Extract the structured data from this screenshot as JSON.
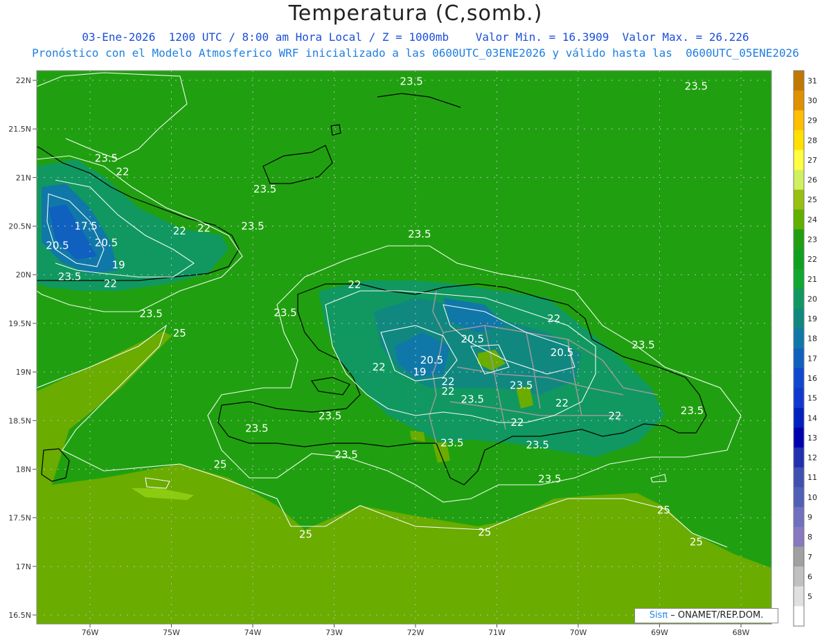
{
  "header": {
    "title": "Temperatura (C,somb.)",
    "line1": "03-Ene-2026  1200 UTC / 8:00 am Hora Local / Z = 1000mb    Valor Min. = 16.3909  Valor Max. = 26.226",
    "line2": "Pronóstico con el Modelo Atmosferico WRF inicializado a las 0600UTC_03ENE2026 y válido hasta las  0600UTC_05ENE2026"
  },
  "axes": {
    "lat_labels": [
      "22N",
      "21.5N",
      "21N",
      "20.5N",
      "20N",
      "19.5N",
      "19N",
      "18.5N",
      "18N",
      "17.5N",
      "17N",
      "16.5N"
    ],
    "lon_labels": [
      "76W",
      "75W",
      "74W",
      "73W",
      "72W",
      "71W",
      "70W",
      "69W",
      "68W"
    ]
  },
  "colorbar": {
    "labels": [
      "31",
      "30",
      "29",
      "28",
      "27",
      "26",
      "25",
      "24",
      "23",
      "22",
      "21",
      "20",
      "19",
      "18",
      "17",
      "16",
      "15",
      "14",
      "13",
      "12",
      "11",
      "10",
      "9",
      "8",
      "7",
      "6",
      "5"
    ],
    "colors": [
      "#c07800",
      "#e09000",
      "#ffbe00",
      "#ffe000",
      "#ffff40",
      "#d0f060",
      "#98c010",
      "#60b000",
      "#20a010",
      "#10a020",
      "#10a830",
      "#109860",
      "#108880",
      "#1078a8",
      "#1060c0",
      "#1048d0",
      "#1038d0",
      "#0020c0",
      "#0000b0",
      "#2030b0",
      "#4050b0",
      "#5060b8",
      "#7070c0",
      "#8878c0",
      "#a0a0a0",
      "#c0c0c0",
      "#e0e0e0",
      "#ffffff"
    ]
  },
  "contour_labels": [
    {
      "text": "23.5",
      "lon": -72.05,
      "lat": 21.99
    },
    {
      "text": "23.5",
      "lon": -68.55,
      "lat": 21.94
    },
    {
      "text": "23.5",
      "lon": -75.8,
      "lat": 21.2
    },
    {
      "text": "22",
      "lon": -75.6,
      "lat": 21.06
    },
    {
      "text": "23.5",
      "lon": -73.85,
      "lat": 20.88
    },
    {
      "text": "17.5",
      "lon": -76.05,
      "lat": 20.5
    },
    {
      "text": "22",
      "lon": -74.9,
      "lat": 20.45
    },
    {
      "text": "22",
      "lon": -74.6,
      "lat": 20.48
    },
    {
      "text": "23.5",
      "lon": -74.0,
      "lat": 20.5
    },
    {
      "text": "23.5",
      "lon": -71.95,
      "lat": 20.42
    },
    {
      "text": "20.5",
      "lon": -76.4,
      "lat": 20.3
    },
    {
      "text": "20.5",
      "lon": -75.8,
      "lat": 20.33
    },
    {
      "text": "19",
      "lon": -75.65,
      "lat": 20.1
    },
    {
      "text": "23.5",
      "lon": -76.25,
      "lat": 19.98
    },
    {
      "text": "22",
      "lon": -75.75,
      "lat": 19.91
    },
    {
      "text": "22",
      "lon": -72.75,
      "lat": 19.9
    },
    {
      "text": "23.5",
      "lon": -75.25,
      "lat": 19.6
    },
    {
      "text": "23.5",
      "lon": -73.6,
      "lat": 19.61
    },
    {
      "text": "25",
      "lon": -74.9,
      "lat": 19.4
    },
    {
      "text": "22",
      "lon": -70.3,
      "lat": 19.55
    },
    {
      "text": "20.5",
      "lon": -71.3,
      "lat": 19.34
    },
    {
      "text": "23.5",
      "lon": -69.2,
      "lat": 19.28
    },
    {
      "text": "20.5",
      "lon": -70.2,
      "lat": 19.2
    },
    {
      "text": "20.5",
      "lon": -71.8,
      "lat": 19.12
    },
    {
      "text": "22",
      "lon": -72.45,
      "lat": 19.05
    },
    {
      "text": "19",
      "lon": -71.95,
      "lat": 19.0
    },
    {
      "text": "22",
      "lon": -71.6,
      "lat": 18.9
    },
    {
      "text": "23.5",
      "lon": -70.7,
      "lat": 18.86
    },
    {
      "text": "22",
      "lon": -71.6,
      "lat": 18.8
    },
    {
      "text": "23.5",
      "lon": -71.3,
      "lat": 18.72
    },
    {
      "text": "22",
      "lon": -70.2,
      "lat": 18.68
    },
    {
      "text": "23.5",
      "lon": -68.6,
      "lat": 18.6
    },
    {
      "text": "23.5",
      "lon": -73.05,
      "lat": 18.55
    },
    {
      "text": "22",
      "lon": -69.55,
      "lat": 18.55
    },
    {
      "text": "22",
      "lon": -70.75,
      "lat": 18.48
    },
    {
      "text": "23.5",
      "lon": -73.95,
      "lat": 18.42
    },
    {
      "text": "23.5",
      "lon": -71.55,
      "lat": 18.27
    },
    {
      "text": "23.5",
      "lon": -70.5,
      "lat": 18.25
    },
    {
      "text": "23.5",
      "lon": -72.85,
      "lat": 18.15
    },
    {
      "text": "25",
      "lon": -74.4,
      "lat": 18.05
    },
    {
      "text": "23.5",
      "lon": -70.35,
      "lat": 17.9
    },
    {
      "text": "25",
      "lon": -68.95,
      "lat": 17.58
    },
    {
      "text": "25",
      "lon": -73.35,
      "lat": 17.33
    },
    {
      "text": "25",
      "lon": -71.15,
      "lat": 17.35
    },
    {
      "text": "25",
      "lon": -68.55,
      "lat": 17.25
    }
  ],
  "credit": {
    "brand": "Sisπ",
    "text": " – ONAMET/REP.DOM."
  }
}
